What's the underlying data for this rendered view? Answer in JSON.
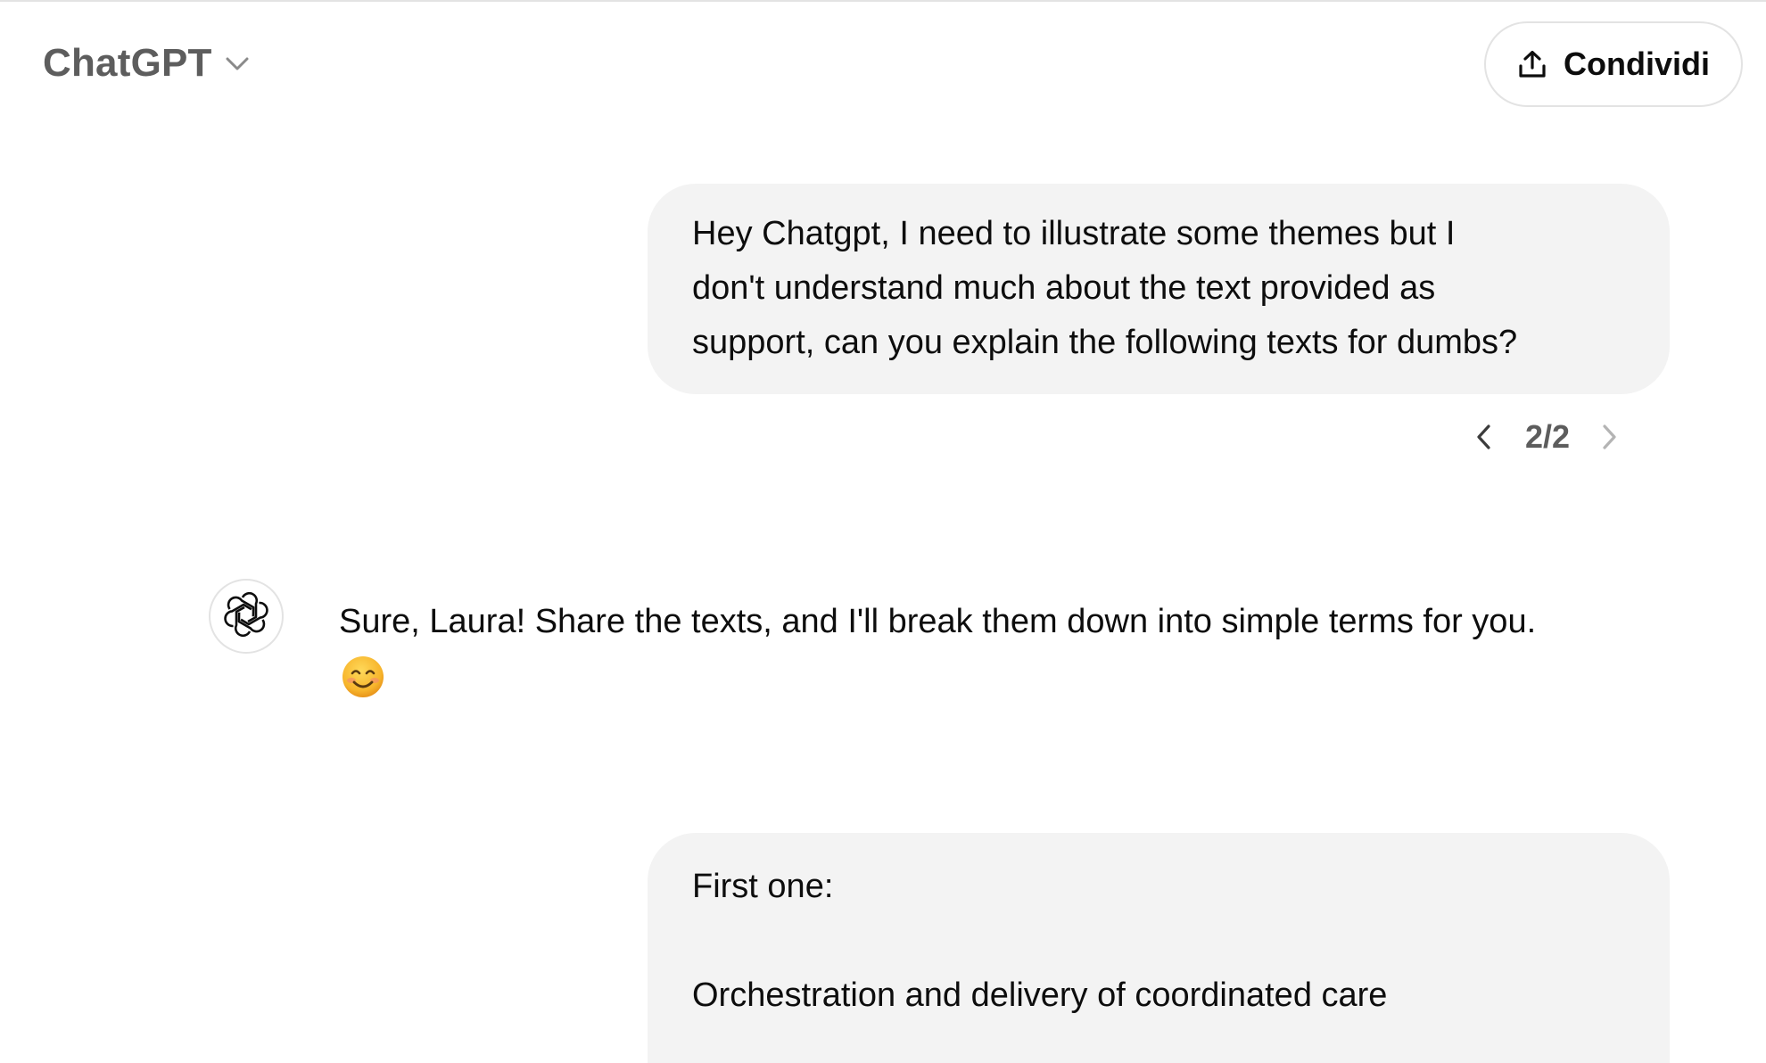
{
  "header": {
    "model_name": "ChatGPT",
    "share_label": "Condividi"
  },
  "messages": [
    {
      "role": "user",
      "lines": [
        "Hey Chatgpt, I need to illustrate some themes but I",
        "don't understand much about the text provided as",
        "support, can you explain the following texts for dumbs?"
      ]
    },
    {
      "role": "assistant",
      "text": "Sure, Laura! Share the texts, and I'll break them down into simple terms for you.",
      "emoji": "smiling-face-icon"
    },
    {
      "role": "user",
      "lines": [
        "First one:",
        "Orchestration and delivery of coordinated care"
      ]
    }
  ],
  "pager": {
    "label": "2/2"
  },
  "icons": {
    "share": "upload-icon",
    "model_dropdown": "chevron-down-icon",
    "pager_prev": "chevron-left-icon",
    "pager_next": "chevron-right-icon",
    "assistant_avatar": "openai-logo-icon"
  },
  "colors": {
    "bubble_bg": "#f3f3f3",
    "muted_text": "#5d5d5d",
    "border": "#e3e3e3"
  }
}
